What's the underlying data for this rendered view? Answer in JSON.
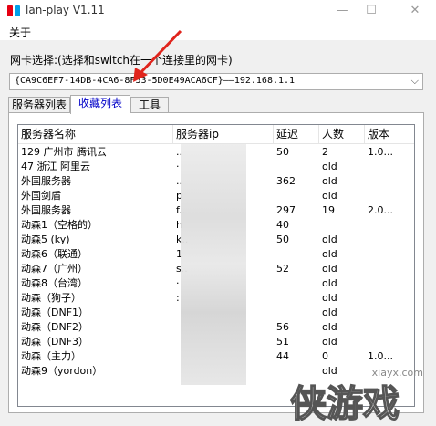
{
  "window": {
    "title": "lan-play V1.11",
    "minimize_glyph": "—",
    "maximize_glyph": "☐",
    "close_glyph": "✕"
  },
  "menu": {
    "about": "关于"
  },
  "nic": {
    "label": "网卡选择:(选择和switch在一个连接里的网卡)",
    "selected": "{CA9C6EF7-14DB-4CA6-8F53-5D0E49ACA6CF}——192.168.1.1"
  },
  "tabs": [
    "服务器列表",
    "收藏列表",
    "工具"
  ],
  "active_tab": 1,
  "table": {
    "columns": [
      "服务器名称",
      "服务器ip",
      "延迟",
      "人数",
      "版本"
    ],
    "rows": [
      {
        "name": "129 广州市 腾讯云",
        "ip": "..",
        "latency": "50",
        "players": "2",
        "version": "1.0..."
      },
      {
        "name": "47 浙江 阿里云",
        "ip": "·",
        "latency": "",
        "players": "old",
        "version": ""
      },
      {
        "name": "外国服务器",
        "ip": "..",
        "latency": "362",
        "players": "old",
        "version": ""
      },
      {
        "name": "外国剑盾",
        "ip": "p",
        "latency": "",
        "players": "old",
        "version": ""
      },
      {
        "name": "外国服务器",
        "ip": "f..",
        "latency": "297",
        "players": "19",
        "version": "2.0..."
      },
      {
        "name": "动森1（空格的）",
        "ip": "h",
        "latency": "40",
        "players": "",
        "version": ""
      },
      {
        "name": "动森5 (ky)",
        "ip": "k..",
        "latency": "50",
        "players": "old",
        "version": ""
      },
      {
        "name": "动森6（联通）",
        "ip": "1",
        "latency": "",
        "players": "old",
        "version": ""
      },
      {
        "name": "动森7（广州）",
        "ip": "s..",
        "latency": "52",
        "players": "old",
        "version": ""
      },
      {
        "name": "动森8（台湾）",
        "ip": "·",
        "latency": "",
        "players": "old",
        "version": ""
      },
      {
        "name": "动森（狗子）",
        "ip": ":",
        "latency": "",
        "players": "old",
        "version": ""
      },
      {
        "name": "动森（DNF1）",
        "ip": "",
        "latency": "",
        "players": "old",
        "version": ""
      },
      {
        "name": "动森（DNF2）",
        "ip": "",
        "latency": "56",
        "players": "old",
        "version": ""
      },
      {
        "name": "动森（DNF3）",
        "ip": "",
        "latency": "51",
        "players": "old",
        "version": ""
      },
      {
        "name": "动森（主力）",
        "ip": "",
        "latency": "44",
        "players": "0",
        "version": "1.0..."
      },
      {
        "name": "动森9（yordon）",
        "ip": "",
        "latency": "",
        "players": "old",
        "version": ""
      }
    ]
  },
  "watermark": {
    "site": "xiayx.com",
    "logo": "侠游戏"
  },
  "colors": {
    "arrow": "#e0241c",
    "active_tab_text": "#0000c8"
  }
}
